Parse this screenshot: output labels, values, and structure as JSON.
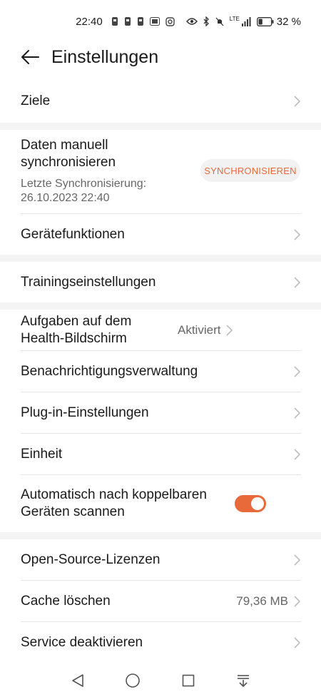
{
  "status_bar": {
    "time": "22:40",
    "battery_percent": "32 %",
    "battery_level": 0.32,
    "network": "LTE",
    "icons": [
      "notification-icon",
      "notification-icon",
      "notification-icon",
      "badge-icon",
      "instagram-icon",
      "eye-icon",
      "bluetooth-icon",
      "mute-icon",
      "lte-icon",
      "signal-icon",
      "battery-icon"
    ]
  },
  "header": {
    "title": "Einstellungen"
  },
  "items": {
    "ziele": "Ziele",
    "sync_title": "Daten manuell synchronisieren",
    "sync_last": "Letzte Synchronisierung: 26.10.2023 22:40",
    "sync_button": "SYNCHRONISIEREN",
    "geraetefunktionen": "Gerätefunktionen",
    "training": "Trainingseinstellungen",
    "aufgaben": "Aufgaben auf dem Health-Bildschirm",
    "aufgaben_value": "Aktiviert",
    "benachrichtigung": "Benachrichtigungsverwaltung",
    "plugin": "Plug-in-Einstellungen",
    "einheit": "Einheit",
    "auto_scan": "Automatisch nach koppelbaren Geräten scannen",
    "auto_scan_on": true,
    "opensource": "Open-Source-Lizenzen",
    "cache": "Cache löschen",
    "cache_value": "79,36 MB",
    "service": "Service deaktivieren"
  },
  "colors": {
    "accent": "#e86a3a",
    "text": "#1a1a1a",
    "secondary": "#666666",
    "divider": "#e6e6e6",
    "section_bg": "#f4f4f4"
  },
  "nav": {
    "icons": [
      "back-triangle-icon",
      "home-circle-icon",
      "recents-square-icon",
      "notification-pull-icon"
    ]
  }
}
